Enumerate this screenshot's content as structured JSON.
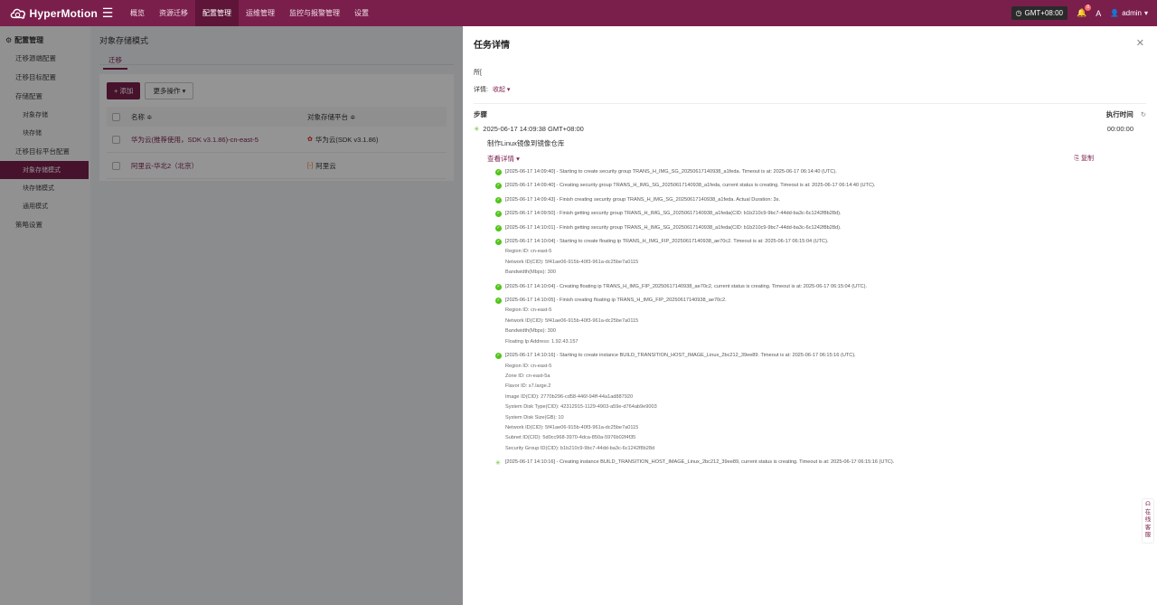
{
  "app": {
    "name": "HyperMotion"
  },
  "nav": [
    {
      "label": "概览"
    },
    {
      "label": "资源迁移"
    },
    {
      "label": "配置管理",
      "active": true
    },
    {
      "label": "运维管理"
    },
    {
      "label": "监控与报警管理"
    },
    {
      "label": "设置"
    }
  ],
  "topbar": {
    "timezone": "GMT+08:00",
    "notify_count": "0",
    "user": "admin"
  },
  "sidebar": {
    "group": "配置管理",
    "items": [
      {
        "label": "迁移源端配置"
      },
      {
        "label": "迁移目标配置"
      },
      {
        "label": "存储配置"
      },
      {
        "label": "对象存储"
      },
      {
        "label": "块存储"
      },
      {
        "label": "迁移目标平台配置"
      },
      {
        "label": "对象存储模式"
      },
      {
        "label": "块存储模式"
      },
      {
        "label": "通用模式"
      },
      {
        "label": "策略设置"
      }
    ]
  },
  "main": {
    "title": "对象存储模式",
    "tab": "迁移",
    "add_button": "+ 添加",
    "more_button": "更多操作",
    "columns": [
      "名称 ≑",
      "对象存储平台 ≑"
    ],
    "rows": [
      {
        "name": "华为云(推荐使用，SDK v3.1.86)-cn-east-5",
        "platform": "华为云(SDK v3.1.86)"
      },
      {
        "name": "阿里云-华北2（北京）",
        "platform": "阿里云"
      }
    ]
  },
  "drawer": {
    "title": "任务详情",
    "info_label": "所[",
    "detail_label": "详情:",
    "collapse": "收起",
    "steps_label": "步骤",
    "exec_time_label": "执行时间",
    "step_time": "2025-06-17 14:09:38 GMT+08:00",
    "step_duration": "00:00:00",
    "step_name": "制作Linux镜像到镜像仓库",
    "view_details": "查看详情",
    "copy": "复制",
    "logs": [
      {
        "status": "ok",
        "lines": [
          "[2025-06-17 14:09:40] - Starting to create security group TRANS_H_IMG_SG_20250617140938_a1feda. Timeout is at: 2025-06-17 06:14:40 (UTC)."
        ]
      },
      {
        "status": "ok",
        "lines": [
          "[2025-06-17 14:09:40] - Creating security group TRANS_H_IMG_SG_20250617140938_a1feda, current status is creating. Timeout is at: 2025-06-17 06:14:40 (UTC)."
        ]
      },
      {
        "status": "ok",
        "lines": [
          "[2025-06-17 14:09:43] - Finish creating security group TRANS_H_IMG_SG_20250617140938_a1feda. Actual Duration: 3s."
        ]
      },
      {
        "status": "ok",
        "lines": [
          "[2025-06-17 14:09:50] - Finish getting security group TRANS_H_IMG_SG_20250617140938_a1feda(CID: b1b210c9-9bc7-44dd-ba3c-6c1242f8b28d)."
        ]
      },
      {
        "status": "ok",
        "lines": [
          "[2025-06-17 14:10:01] - Finish getting security group TRANS_H_IMG_SG_20250617140938_a1feda(CID: b1b210c9-9bc7-44dd-ba3c-6c1242f8b28d)."
        ]
      },
      {
        "status": "ok",
        "lines": [
          "[2025-06-17 14:10:04] - Starting to create floating ip TRANS_H_IMG_FIP_20250617140938_ae70c2. Timeout is at: 2025-06-17 06:15:04 (UTC).",
          "Region ID: cn-east-5",
          "Network ID(CID): 5f41ae06-915b-40f3-961a-dc25be7a0115",
          "Bandwidth(Mbps): 300"
        ]
      },
      {
        "status": "ok",
        "lines": [
          "[2025-06-17 14:10:04] - Creating floating ip TRANS_H_IMG_FIP_20250617140938_ae70c2, current status is creating. Timeout is at: 2025-06-17 06:15:04 (UTC)."
        ]
      },
      {
        "status": "ok",
        "lines": [
          "[2025-06-17 14:10:05] - Finish creating floating ip TRANS_H_IMG_FIP_20250617140938_ae70c2.",
          "Region ID: cn-east-5",
          "Network ID(CID): 5f41ae06-915b-40f3-961a-dc25be7a0115",
          "Bandwidth(Mbps): 300",
          "Floating Ip Address: 1.92.43.157"
        ]
      },
      {
        "status": "ok",
        "lines": [
          "[2025-06-17 14:10:16] - Starting to create instance BUILD_TRANSITION_HOST_IMAGE_Linux_2bc212_39ee89. Timeout is at: 2025-06-17 06:15:16 (UTC).",
          "Region ID: cn-east-5",
          "Zone ID: cn-east-5a",
          "Flavor ID: s7.large.2",
          "Image ID(CID): 2770b296-cd58-446f-94ff-44a1ad887920",
          "System Disk Type(CID): 42312915-1129-4903-a59e-d764ab9e9003",
          "System Disk Size(GB): 10",
          "Network ID(CID): 5f41ae06-915b-40f3-961a-dc25be7a0115",
          "Subnet ID(CID): 5d0cc968-3970-4dca-850a-5976b02f4f35",
          "Security Group ID(CID): b1b210c9-9bc7-44dd-ba3c-6c1242f8b28d"
        ]
      },
      {
        "status": "pending",
        "lines": [
          "[2025-06-17 14:10:16] - Creating instance BUILD_TRANSITION_HOST_IMAGE_Linux_2bc212_39ee89, current status is creating. Timeout is at: 2025-06-17 06:15:16 (UTC)."
        ]
      }
    ]
  },
  "support": {
    "label": "在线客服"
  },
  "colors": {
    "brand": "#7a1f4c",
    "success": "#52c41a"
  }
}
